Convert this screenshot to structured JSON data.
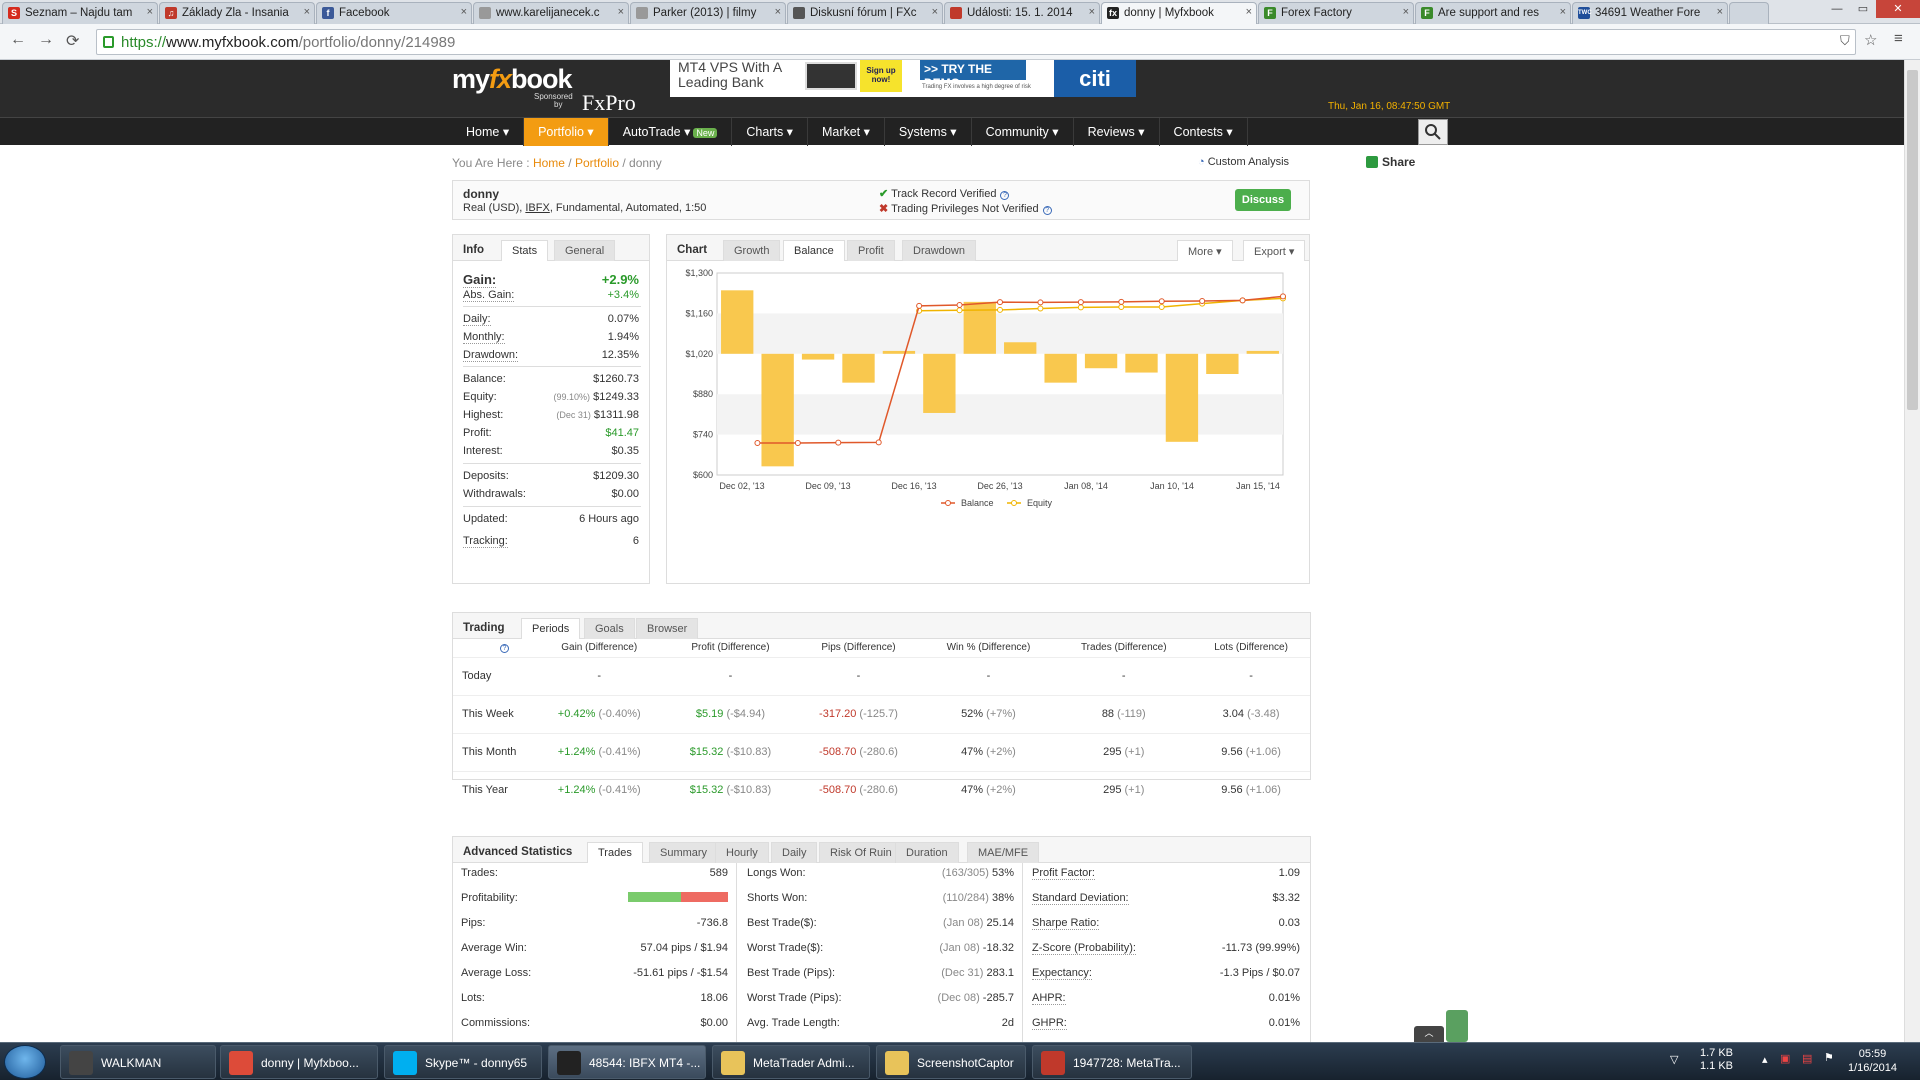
{
  "browser": {
    "tabs": [
      {
        "title": "Seznam – Najdu tam",
        "icon": "seznam-icon",
        "color": "#d52b1e",
        "letter": "S"
      },
      {
        "title": "Základy Zla - Insania",
        "icon": "music-icon",
        "color": "#c0392b",
        "letter": "♫"
      },
      {
        "title": "Facebook",
        "icon": "facebook-icon",
        "color": "#3b5998",
        "letter": "f"
      },
      {
        "title": "www.karelijanecek.c",
        "icon": "page-icon",
        "color": "#999999",
        "letter": ""
      },
      {
        "title": "Parker (2013) | filmy",
        "icon": "page-icon",
        "color": "#999999",
        "letter": ""
      },
      {
        "title": "Diskusní fórum | FXc",
        "icon": "forum-icon",
        "color": "#555555",
        "letter": ""
      },
      {
        "title": "Události: 15. 1. 2014",
        "icon": "ct-icon",
        "color": "#c0392b",
        "letter": ""
      },
      {
        "title": "donny | Myfxbook",
        "icon": "myfxbook-icon",
        "color": "#222222",
        "letter": "fx"
      },
      {
        "title": "Forex Factory",
        "icon": "forexfactory-icon",
        "color": "#3a8a2a",
        "letter": "F"
      },
      {
        "title": "Are support and res",
        "icon": "forexfactory-icon",
        "color": "#3a8a2a",
        "letter": "F"
      },
      {
        "title": "34691 Weather Fore",
        "icon": "twc-icon",
        "color": "#1f4e9a",
        "letter": "TWC"
      }
    ],
    "url_prefix": "https://",
    "url_host": "www.myfxbook.com",
    "url_path": "/portfolio/donny/214989"
  },
  "header": {
    "logo_my": "my",
    "logo_fx": "fx",
    "logo_book": "book",
    "sponsored": "Sponsored",
    "by": "by",
    "fxpro": "FxPro",
    "clock": "Thu, Jan 16, 08:47:50 GMT"
  },
  "ad": {
    "line1": "MT4 VPS With A",
    "line2": "Leading Bank",
    "signup": "Sign up now!",
    "demo": ">> TRY THE DEMO",
    "disclaimer": "Trading FX involves a high degree of risk",
    "brand": "citi"
  },
  "menu": [
    {
      "label": "Home ▾",
      "active": false
    },
    {
      "label": "Portfolio ▾",
      "active": true
    },
    {
      "label": "AutoTrade ▾",
      "active": false,
      "badge": "New"
    },
    {
      "label": "Charts ▾",
      "active": false
    },
    {
      "label": "Market ▾",
      "active": false
    },
    {
      "label": "Systems ▾",
      "active": false
    },
    {
      "label": "Community ▾",
      "active": false
    },
    {
      "label": "Reviews ▾",
      "active": false
    },
    {
      "label": "Contests ▾",
      "active": false
    }
  ],
  "breadcrumb": {
    "prefix": "You Are Here :",
    "home": "Home",
    "portfolio": "Portfolio",
    "current": "donny"
  },
  "custom_analysis": "Custom Analysis",
  "share": "Share",
  "account": {
    "name": "donny",
    "type_pre": "Real (USD),",
    "broker": "IBFX",
    "type_post": ", Fundamental, Automated, 1:50",
    "verified": "Track Record Verified",
    "not_verified": "Trading Privileges Not Verified",
    "discuss": "Discuss"
  },
  "info_panel": {
    "tabs": [
      "Info",
      "Stats",
      "General"
    ],
    "gain_label": "Gain:",
    "gain": "+2.9%",
    "abs_gain_label": "Abs. Gain:",
    "abs_gain": "+3.4%",
    "daily_label": "Daily:",
    "daily": "0.07%",
    "monthly_label": "Monthly:",
    "monthly": "1.94%",
    "drawdown_label": "Drawdown:",
    "drawdown": "12.35%",
    "balance_label": "Balance:",
    "balance": "$1260.73",
    "equity_label": "Equity:",
    "equity_pct": "(99.10%)",
    "equity": "$1249.33",
    "highest_label": "Highest:",
    "highest_date": "(Dec 31)",
    "highest": "$1311.98",
    "profit_label": "Profit:",
    "profit": "$41.47",
    "interest_label": "Interest:",
    "interest": "$0.35",
    "deposits_label": "Deposits:",
    "deposits": "$1209.30",
    "withdrawals_label": "Withdrawals:",
    "withdrawals": "$0.00",
    "updated_label": "Updated:",
    "updated": "6 Hours ago",
    "tracking_label": "Tracking:",
    "tracking": "6"
  },
  "chart_panel": {
    "tabs": [
      "Chart",
      "Growth",
      "Balance",
      "Profit",
      "Drawdown"
    ],
    "more": "More",
    "export": "Export"
  },
  "chart_data": {
    "type": "bar",
    "series_labels": [
      "Balance",
      "Equity"
    ],
    "ylim": [
      600,
      1300
    ],
    "yticks": [
      "$1,300",
      "$1,160",
      "$1,020",
      "$880",
      "$740",
      "$600"
    ],
    "xticks": [
      "Dec 02, '13",
      "Dec 09, '13",
      "Dec 16, '13",
      "Dec 26, '13",
      "Jan 08, '14",
      "Jan 10, '14",
      "Jan 15, '14"
    ],
    "daily_bars": [
      {
        "index": 0,
        "from": 1020,
        "to": 1240
      },
      {
        "index": 1,
        "from": 1020,
        "to": 630
      },
      {
        "index": 2,
        "from": 1020,
        "to": 1000
      },
      {
        "index": 3,
        "from": 1020,
        "to": 920
      },
      {
        "index": 4,
        "from": 1020,
        "to": 1030
      },
      {
        "index": 5,
        "from": 1020,
        "to": 815
      },
      {
        "index": 6,
        "from": 1020,
        "to": 1200
      },
      {
        "index": 7,
        "from": 1020,
        "to": 1060
      },
      {
        "index": 8,
        "from": 1020,
        "to": 920
      },
      {
        "index": 9,
        "from": 1020,
        "to": 970
      },
      {
        "index": 10,
        "from": 1020,
        "to": 955
      },
      {
        "index": 11,
        "from": 1020,
        "to": 715
      },
      {
        "index": 12,
        "from": 1020,
        "to": 950
      },
      {
        "index": 13,
        "from": 1020,
        "to": 1030
      }
    ],
    "balance": [
      {
        "index": 0.5,
        "value": 711
      },
      {
        "index": 1.5,
        "value": 711
      },
      {
        "index": 2.5,
        "value": 712
      },
      {
        "index": 3.5,
        "value": 713
      },
      {
        "index": 4.5,
        "value": 1186
      },
      {
        "index": 5.5,
        "value": 1189
      },
      {
        "index": 6.5,
        "value": 1199
      },
      {
        "index": 7.5,
        "value": 1198
      },
      {
        "index": 8.5,
        "value": 1199
      },
      {
        "index": 9.5,
        "value": 1200
      },
      {
        "index": 10.5,
        "value": 1202
      },
      {
        "index": 11.5,
        "value": 1203
      },
      {
        "index": 12.5,
        "value": 1205
      },
      {
        "index": 13.5,
        "value": 1219
      }
    ],
    "equity": [
      {
        "index": 4.5,
        "value": 1169
      },
      {
        "index": 5.5,
        "value": 1171
      },
      {
        "index": 6.5,
        "value": 1172
      },
      {
        "index": 7.5,
        "value": 1177
      },
      {
        "index": 8.5,
        "value": 1181
      },
      {
        "index": 9.5,
        "value": 1182
      },
      {
        "index": 10.5,
        "value": 1182
      },
      {
        "index": 11.5,
        "value": 1194
      },
      {
        "index": 12.5,
        "value": 1205
      },
      {
        "index": 13.5,
        "value": 1212
      }
    ],
    "colors": {
      "bar": "#f9c84e",
      "balance": "#e0582a",
      "equity": "#f0b400"
    }
  },
  "trading": {
    "tabs": [
      "Trading",
      "Periods",
      "Goals",
      "Browser"
    ],
    "headers": [
      "",
      "Gain (Difference)",
      "Profit (Difference)",
      "Pips (Difference)",
      "Win % (Difference)",
      "Trades (Difference)",
      "Lots (Difference)"
    ],
    "rows": [
      {
        "period": "Today",
        "gain": "-",
        "gain_d": "",
        "profit": "-",
        "profit_d": "",
        "pips": "-",
        "pips_d": "",
        "win": "-",
        "win_d": "",
        "trades": "-",
        "trades_d": "",
        "lots": "-",
        "lots_d": ""
      },
      {
        "period": "This Week",
        "gain": "+0.42%",
        "gain_d": "(-0.40%)",
        "profit": "$5.19",
        "profit_d": "(-$4.94)",
        "pips": "-317.20",
        "pips_d": "(-125.7)",
        "win": "52%",
        "win_d": "(+7%)",
        "trades": "88",
        "trades_d": "(-119)",
        "lots": "3.04",
        "lots_d": "(-3.48)"
      },
      {
        "period": "This Month",
        "gain": "+1.24%",
        "gain_d": "(-0.41%)",
        "profit": "$15.32",
        "profit_d": "(-$10.83)",
        "pips": "-508.70",
        "pips_d": "(-280.6)",
        "win": "47%",
        "win_d": "(+2%)",
        "trades": "295",
        "trades_d": "(+1)",
        "lots": "9.56",
        "lots_d": "(+1.06)"
      },
      {
        "period": "This Year",
        "gain": "+1.24%",
        "gain_d": "(-0.41%)",
        "profit": "$15.32",
        "profit_d": "(-$10.83)",
        "pips": "-508.70",
        "pips_d": "(-280.6)",
        "win": "47%",
        "win_d": "(+2%)",
        "trades": "295",
        "trades_d": "(+1)",
        "lots": "9.56",
        "lots_d": "(+1.06)"
      }
    ]
  },
  "advanced": {
    "tabs": [
      "Advanced Statistics",
      "Trades",
      "Summary",
      "Hourly",
      "Daily",
      "Risk Of Ruin",
      "Duration",
      "MAE/MFE"
    ],
    "profitability_won_pct": 53,
    "col1": [
      {
        "label": "Trades:",
        "value": ""
      },
      {
        "label": "Profitability:",
        "value": ""
      },
      {
        "label": "Pips:",
        "value": "-736.8"
      },
      {
        "label": "Average Win:",
        "value": "57.04 pips / $1.94"
      },
      {
        "label": "Average Loss:",
        "value": "-51.61 pips / -$1.54"
      },
      {
        "label": "Lots:",
        "value": "18.06"
      },
      {
        "label": "Commissions:",
        "value": "$0.00"
      }
    ],
    "trades_value": "589",
    "col2": [
      {
        "label": "Longs Won:",
        "note": "(163/305)",
        "value": "53%"
      },
      {
        "label": "Shorts Won:",
        "note": "(110/284)",
        "value": "38%"
      },
      {
        "label": "Best Trade($):",
        "note": "(Jan 08)",
        "value": "25.14"
      },
      {
        "label": "Worst Trade($):",
        "note": "(Jan 08)",
        "value": "-18.32"
      },
      {
        "label": "Best Trade (Pips):",
        "note": "(Dec 31)",
        "value": "283.1"
      },
      {
        "label": "Worst Trade (Pips):",
        "note": "(Dec 08)",
        "value": "-285.7"
      },
      {
        "label": "Avg. Trade Length:",
        "note": "",
        "value": "2d"
      }
    ],
    "col3": [
      {
        "label": "Profit Factor:",
        "value": "1.09"
      },
      {
        "label": "Standard Deviation:",
        "value": "$3.32"
      },
      {
        "label": "Sharpe Ratio:",
        "value": "0.03"
      },
      {
        "label": "Z-Score (Probability):",
        "value": "-11.73 (99.99%)"
      },
      {
        "label": "Expectancy:",
        "value": "-1.3 Pips / $0.07"
      },
      {
        "label": "AHPR:",
        "value": "0.01%"
      },
      {
        "label": "GHPR:",
        "value": "0.01%"
      }
    ]
  },
  "taskbar": {
    "items": [
      {
        "label": "WALKMAN",
        "icon": "walkman-icon",
        "color": "#444444"
      },
      {
        "label": "donny | Myfxboo...",
        "icon": "chrome-icon",
        "color": "#dd4b39"
      },
      {
        "label": "Skype™ - donny65",
        "icon": "skype-icon",
        "color": "#00aff0"
      },
      {
        "label": "48544: IBFX MT4 -...",
        "icon": "ibfx-icon",
        "color": "#222222"
      },
      {
        "label": "MetaTrader Admi...",
        "icon": "folder-icon",
        "color": "#e8c35a"
      },
      {
        "label": "ScreenshotCaptor",
        "icon": "folder-icon",
        "color": "#e8c35a"
      },
      {
        "label": "1947728: MetaTra...",
        "icon": "metatrader-icon",
        "color": "#c0392b"
      }
    ],
    "net_up": "1.7 KB",
    "net_down": "1.1 KB",
    "time": "05:59",
    "date": "1/16/2014"
  }
}
